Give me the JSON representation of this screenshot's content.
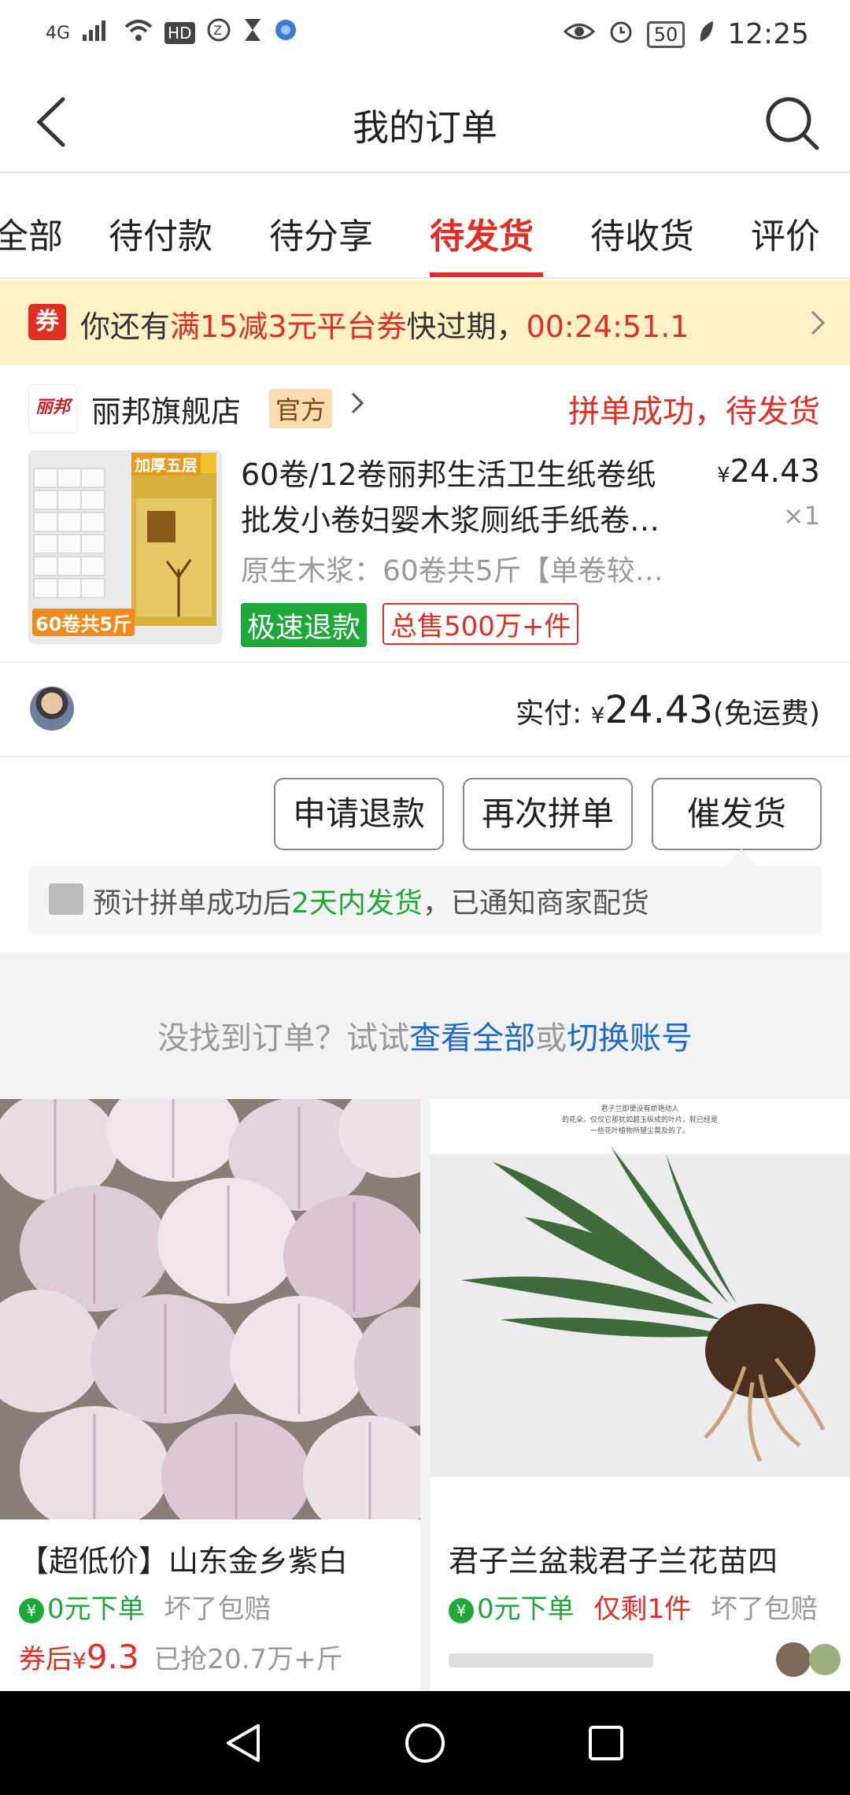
{
  "status_bar": {
    "network": "4G",
    "hd": "HD",
    "battery": "50",
    "time": "12:25"
  },
  "header": {
    "title": "我的订单"
  },
  "tabs": [
    {
      "label": "全部"
    },
    {
      "label": "待付款"
    },
    {
      "label": "待分享"
    },
    {
      "label": "待发货",
      "active": true
    },
    {
      "label": "待收货"
    },
    {
      "label": "评价"
    }
  ],
  "banner": {
    "icon": "券",
    "prefix": "你还有",
    "coupon": "满15减3元平台券",
    "middle": "快过期，",
    "countdown": "00:24:51.1"
  },
  "order": {
    "shop_logo_text": "丽邦",
    "shop_name": "丽邦旗舰店",
    "official_tag": "官方",
    "status": "拼单成功，待发货",
    "product_title_line1": "60卷/12卷丽邦生活卫生纸卷纸",
    "product_title_line2": "批发小卷妇婴木浆厕纸手纸卷…",
    "price_symbol": "¥",
    "price": "24.43",
    "qty": "×1",
    "spec": "原生木浆：60卷共5斤【单卷较…",
    "tag_refund": "极速退款",
    "tag_sales": "总售500万+件",
    "img_label_top": "加厚五层",
    "img_label_bottom": "60卷共5斤",
    "paid_label": "实付:",
    "paid_symbol": "¥",
    "paid_amount": "24.43",
    "paid_note": "(免运费)",
    "buttons": {
      "refund": "申请退款",
      "regroup": "再次拼单",
      "urge": "催发货"
    },
    "ship_note_prefix": "预计拼单成功后",
    "ship_note_highlight": "2天内发货",
    "ship_note_suffix": "，已通知商家配货"
  },
  "not_found": {
    "prefix": "没找到订单？试试",
    "view_all": "查看全部",
    "or": "或",
    "switch": "切换账号"
  },
  "products": [
    {
      "title": "【超低价】山东金乡紫白",
      "zero_order": "0元下单",
      "guarantee": "坏了包赔",
      "coupon_label": "券后",
      "price_symbol": "¥",
      "price": "9.3",
      "sold": "已抢20.7万+斤"
    },
    {
      "title": "君子兰盆栽君子兰花苗四",
      "zero_order": "0元下单",
      "stock": "仅剩1件",
      "guarantee": "坏了包赔",
      "img_caption_1": "君子兰即便没有娇艳动人",
      "img_caption_2": "的花朵，仅仅它那犹如碧玉纵成的叶片，就已经是",
      "img_caption_3": "一些花叶植物所望尘莫及的了。"
    }
  ]
}
